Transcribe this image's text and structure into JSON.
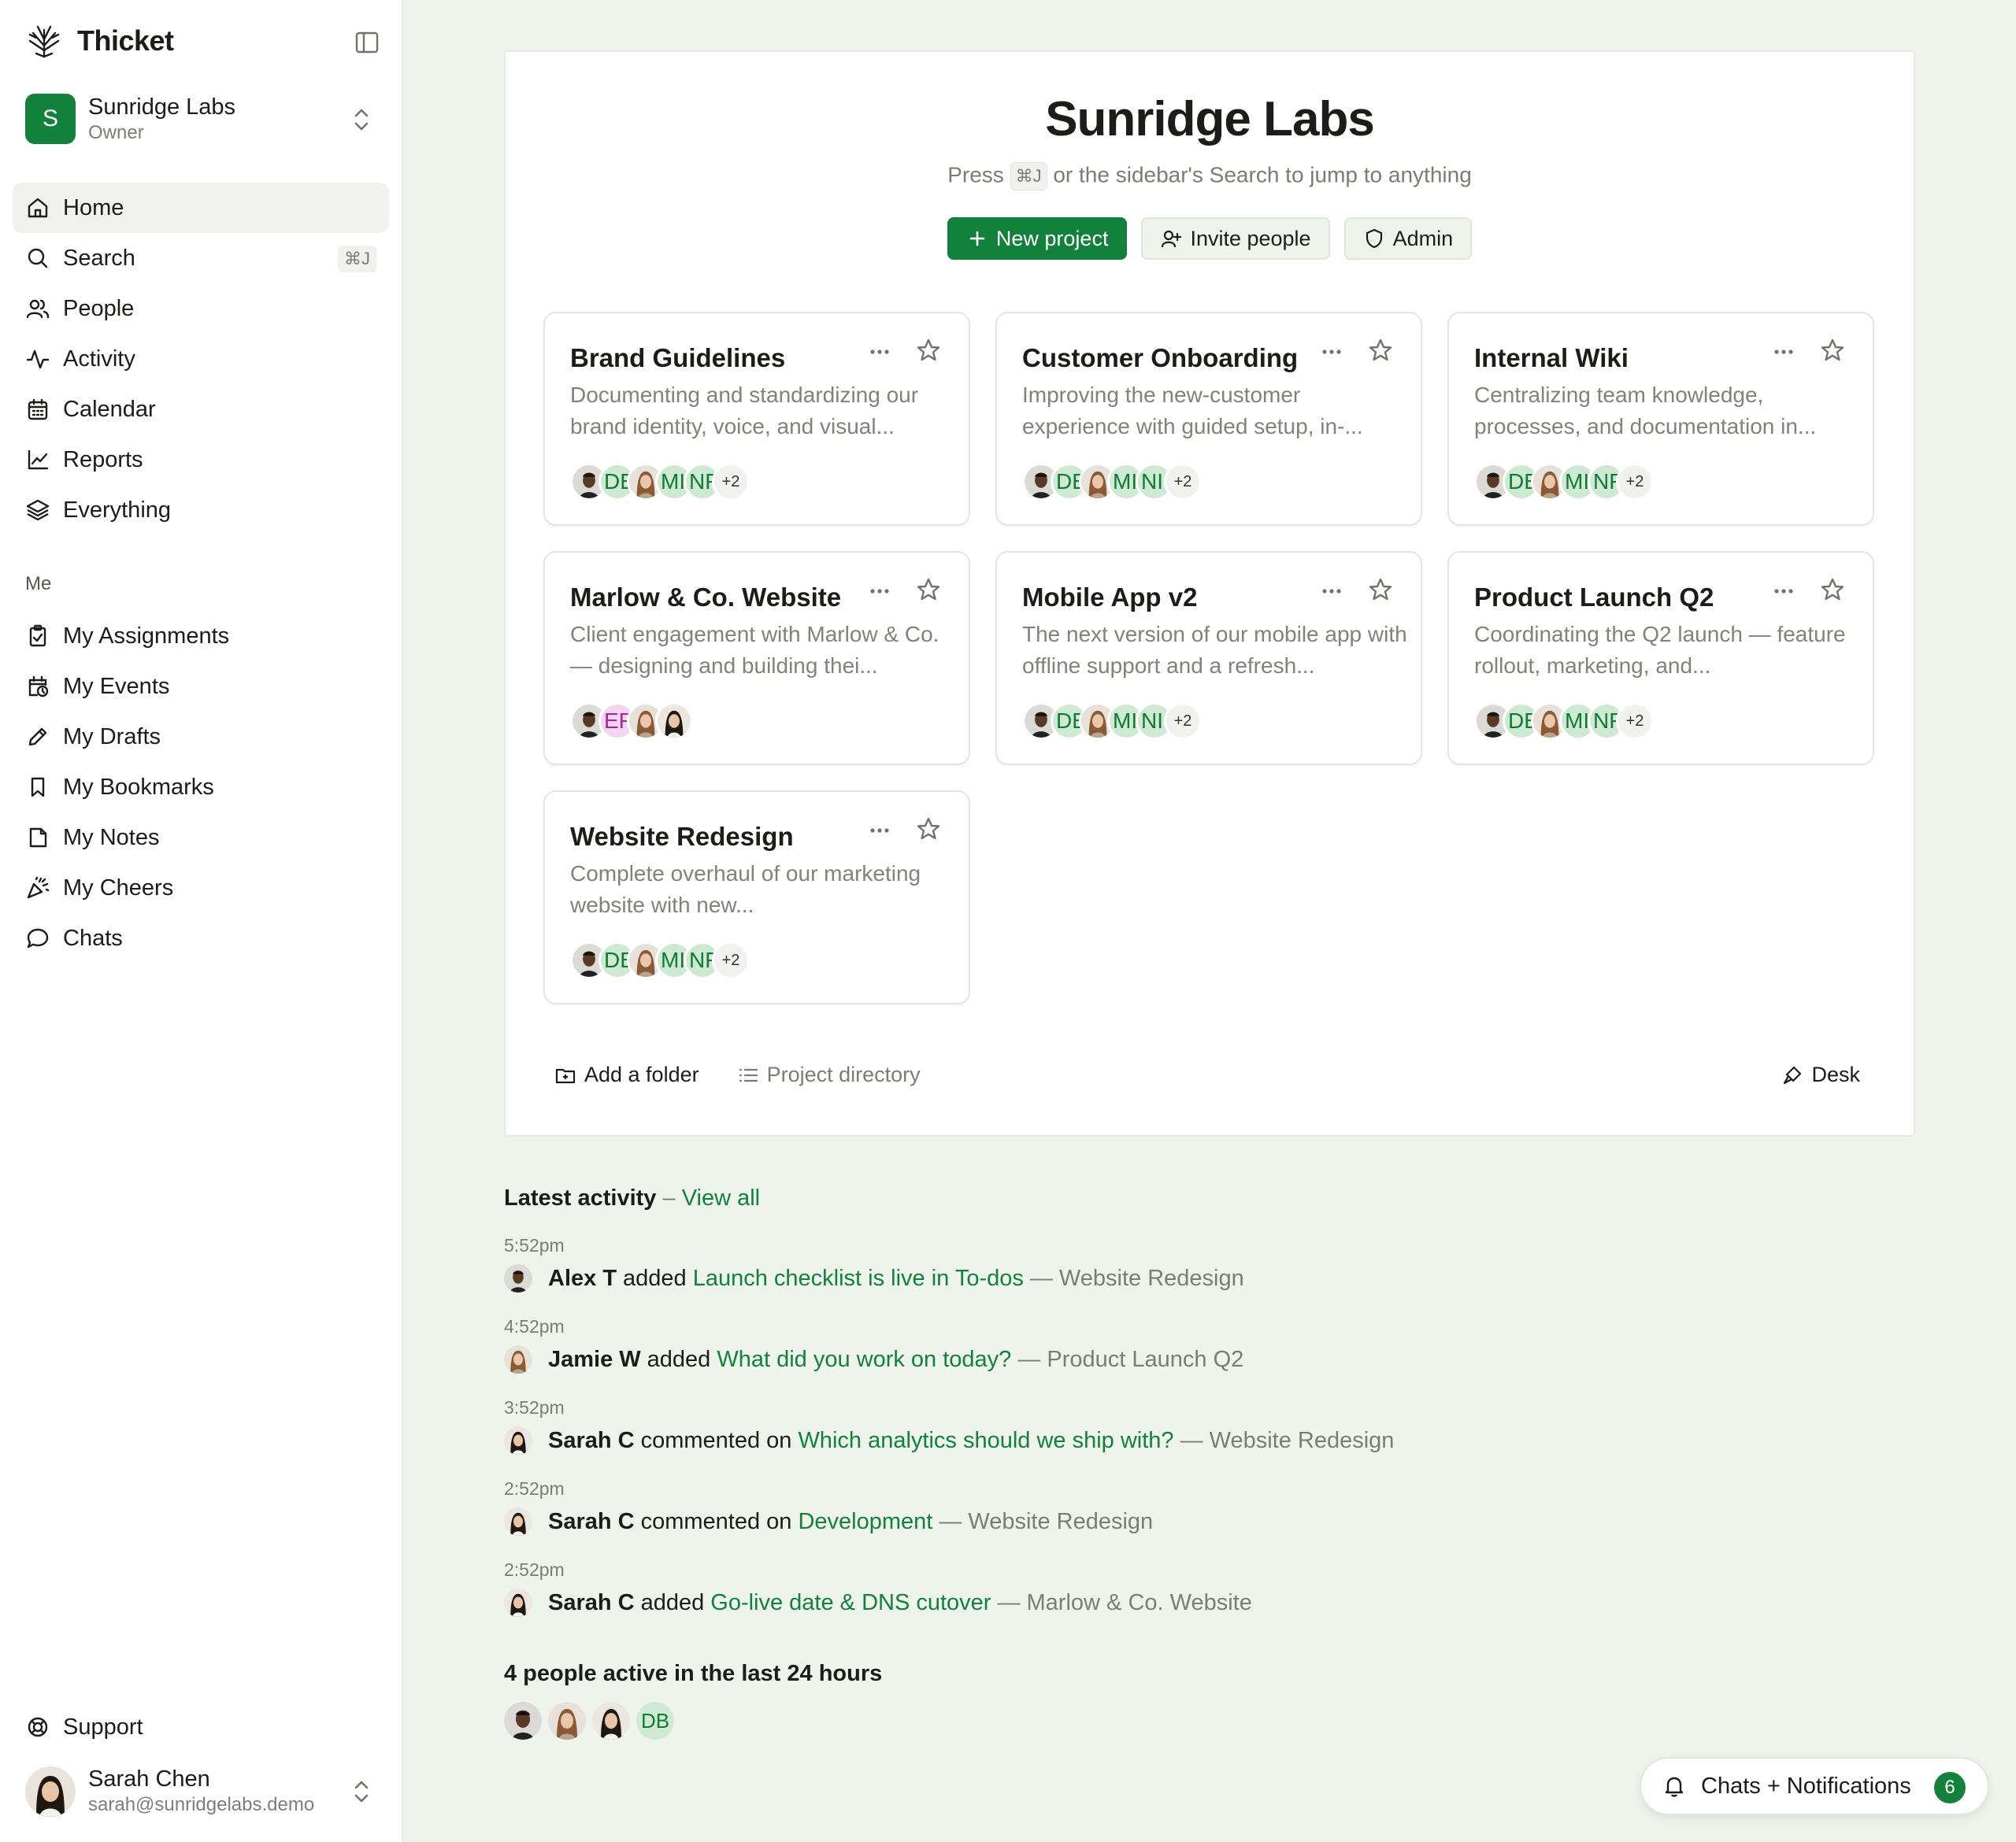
{
  "app": {
    "name": "Thicket"
  },
  "org": {
    "initial": "S",
    "name": "Sunridge Labs",
    "role": "Owner"
  },
  "nav": [
    {
      "label": "Home",
      "icon": "home-icon",
      "active": true
    },
    {
      "label": "Search",
      "icon": "search-icon",
      "shortcut": "⌘J"
    },
    {
      "label": "People",
      "icon": "people-icon"
    },
    {
      "label": "Activity",
      "icon": "activity-icon"
    },
    {
      "label": "Calendar",
      "icon": "calendar-icon"
    },
    {
      "label": "Reports",
      "icon": "chart-icon"
    },
    {
      "label": "Everything",
      "icon": "layers-icon"
    }
  ],
  "me_section": {
    "title": "Me",
    "items": [
      {
        "label": "My Assignments",
        "icon": "clipboard-check-icon"
      },
      {
        "label": "My Events",
        "icon": "calendar-clock-icon"
      },
      {
        "label": "My Drafts",
        "icon": "pencil-icon"
      },
      {
        "label": "My Bookmarks",
        "icon": "bookmark-icon"
      },
      {
        "label": "My Notes",
        "icon": "note-icon"
      },
      {
        "label": "My Cheers",
        "icon": "party-popper-icon"
      },
      {
        "label": "Chats",
        "icon": "chat-bubble-icon"
      }
    ]
  },
  "support": {
    "label": "Support",
    "icon": "lifebuoy-icon"
  },
  "user": {
    "name": "Sarah Chen",
    "email": "sarah@sunridgelabs.demo"
  },
  "main": {
    "title": "Sunridge Labs",
    "subtitle_pre": "Press",
    "subtitle_kbd": "⌘J",
    "subtitle_post": "or the sidebar's Search to jump to anything",
    "actions": {
      "new_project": "New project",
      "invite": "Invite people",
      "admin": "Admin"
    }
  },
  "projects": [
    {
      "title": "Brand Guidelines",
      "desc": "Documenting and standardizing our brand identity, voice, and visual...",
      "members": [
        "photo-m",
        "DE",
        "photo-f",
        "MI",
        "NF"
      ],
      "more": "+2"
    },
    {
      "title": "Customer Onboarding",
      "desc": "Improving the new-customer experience with guided setup, in-...",
      "members": [
        "photo-m",
        "DE",
        "photo-f",
        "MI",
        "NI"
      ],
      "more": "+2"
    },
    {
      "title": "Internal Wiki",
      "desc": "Centralizing team knowledge, processes, and documentation in...",
      "members": [
        "photo-m",
        "DE",
        "photo-f",
        "MI",
        "NF"
      ],
      "more": "+2"
    },
    {
      "title": "Marlow & Co. Website",
      "desc": "Client engagement with Marlow & Co. — designing and building thei...",
      "members": [
        "photo-m",
        "EF",
        "photo-f",
        "photo-w"
      ],
      "more": ""
    },
    {
      "title": "Mobile App v2",
      "desc": "The next version of our mobile app with offline support and a refresh...",
      "members": [
        "photo-m",
        "DE",
        "photo-f",
        "MI",
        "NI"
      ],
      "more": "+2"
    },
    {
      "title": "Product Launch Q2",
      "desc": "Coordinating the Q2 launch — feature rollout, marketing, and...",
      "members": [
        "photo-m",
        "DE",
        "photo-f",
        "MI",
        "NF"
      ],
      "more": "+2"
    },
    {
      "title": "Website Redesign",
      "desc": "Complete overhaul of our marketing website with new...",
      "members": [
        "photo-m",
        "DE",
        "photo-f",
        "MI",
        "NF"
      ],
      "more": "+2"
    }
  ],
  "footer": {
    "add_folder": "Add a folder",
    "directory": "Project directory",
    "desk": "Desk"
  },
  "activity": {
    "title": "Latest activity",
    "sep": "–",
    "view_all": "View all",
    "entries": [
      {
        "time": "5:52pm",
        "who": "Alex T",
        "verb": "added",
        "target": "Launch checklist is live in To-dos",
        "project": "— Website Redesign",
        "avatar": "photo-m"
      },
      {
        "time": "4:52pm",
        "who": "Jamie W",
        "verb": "added",
        "target": "What did you work on today?",
        "project": "— Product Launch Q2",
        "avatar": "photo-f"
      },
      {
        "time": "3:52pm",
        "who": "Sarah C",
        "verb": "commented on",
        "target": "Which analytics should we ship with?",
        "project": "— Website Redesign",
        "avatar": "photo-w"
      },
      {
        "time": "2:52pm",
        "who": "Sarah C",
        "verb": "commented on",
        "target": "Development",
        "project": "— Website Redesign",
        "avatar": "photo-w"
      },
      {
        "time": "2:52pm",
        "who": "Sarah C",
        "verb": "added",
        "target": "Go-live date & DNS cutover",
        "project": "— Marlow & Co. Website",
        "avatar": "photo-w"
      }
    ]
  },
  "active_people": {
    "title": "4 people active in the last 24 hours",
    "initials": "DB"
  },
  "notifications": {
    "label": "Chats + Notifications",
    "count": "6"
  },
  "colors": {
    "brand": "#12813b",
    "background": "#eef4ec"
  }
}
